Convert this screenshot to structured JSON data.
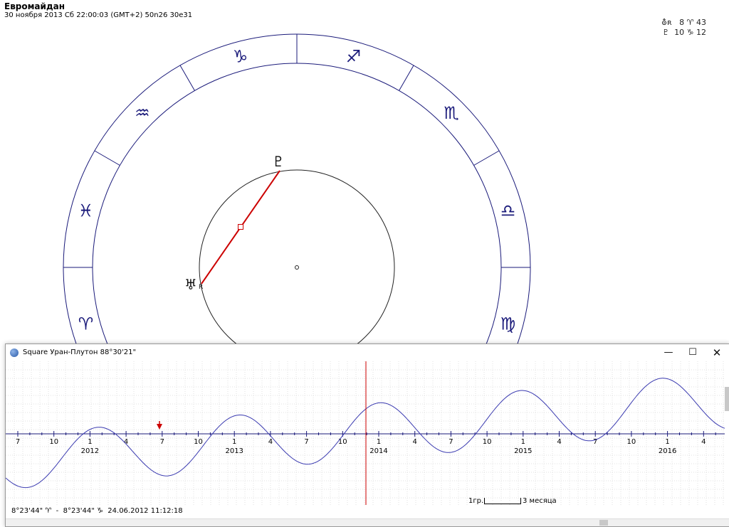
{
  "header": {
    "title": "Евромайдан",
    "subtitle": "30 ноября 2013  Сб  22:00:03 (GMT+2) 50n26  30e31",
    "positions": [
      "⛢ʀ   8 ♈ 43",
      "♇  10 ♑ 12"
    ]
  },
  "chart": {
    "signs": [
      "♈",
      "♓",
      "♒",
      "♑",
      "♐",
      "♏",
      "♎",
      "♍"
    ],
    "planets": {
      "pluto_glyph": "♇",
      "uranus_glyph": "♅",
      "uranus_retro": "R"
    },
    "aspect_color": "#cc0000",
    "ring_color": "#1a1a7a"
  },
  "window": {
    "title": "Square Уран-Плутон  88°30'21\"",
    "minimize": "—",
    "maximize": "☐",
    "close": "✕"
  },
  "graph": {
    "month_labels": [
      "7",
      "10",
      "1",
      "4",
      "7",
      "10",
      "1",
      "4",
      "7",
      "10",
      "1",
      "4",
      "7",
      "10",
      "1",
      "4",
      "7",
      "10",
      "1",
      "4"
    ],
    "year_labels": [
      "2012",
      "2013",
      "2014",
      "2015",
      "2016"
    ],
    "scale_label": "1гр.",
    "scale_unit": "3 месяца",
    "status": "8°23'44\" ♈  -  8°23'44\" ♑  24.06.2012 11:12:18",
    "curve_color": "#3a3ab0",
    "cursor_color": "#cc0000"
  },
  "icons": {
    "app": "app-globe-icon",
    "marker": "red-arrow-marker-icon"
  }
}
